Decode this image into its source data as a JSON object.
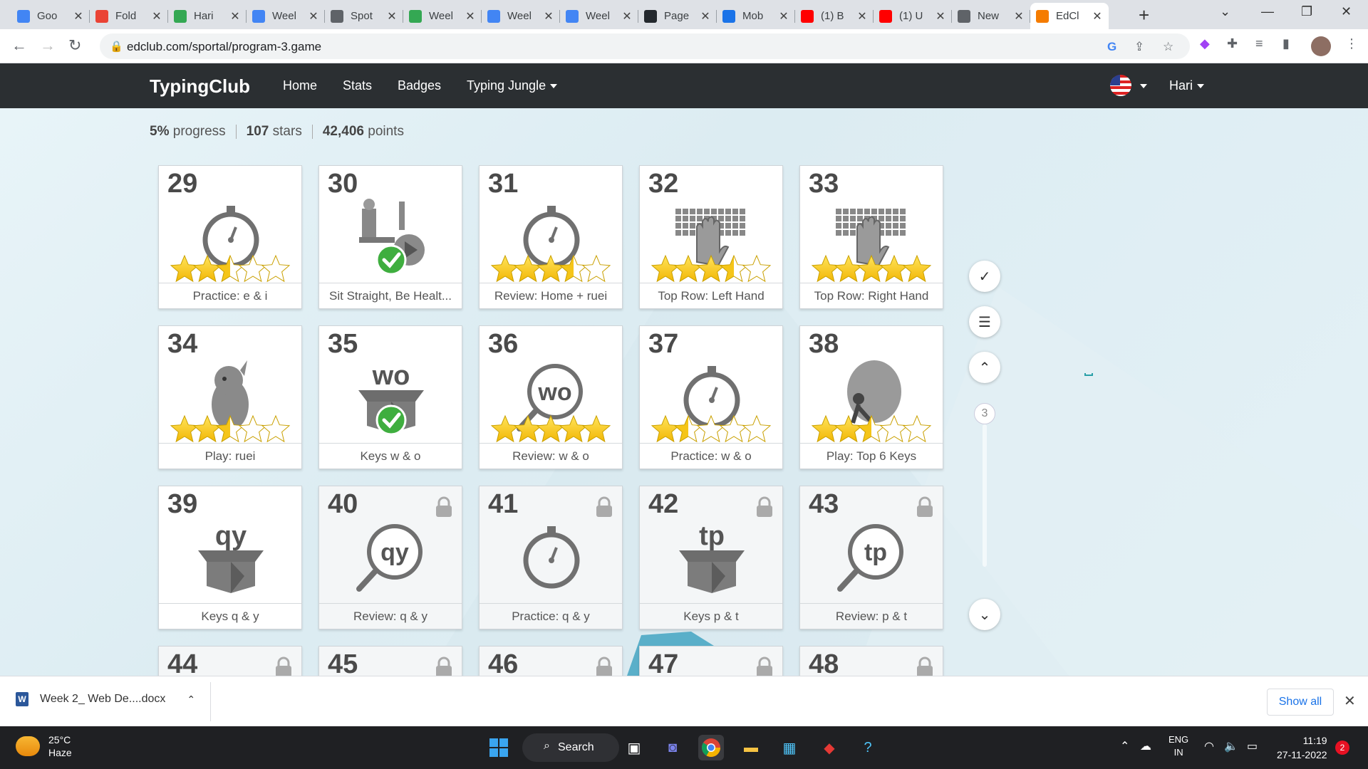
{
  "browser": {
    "tabs": [
      {
        "label": "Goo",
        "icon": "google-icon",
        "color": "#4285f4"
      },
      {
        "label": "Fold",
        "icon": "gmail-icon",
        "color": "#ea4335"
      },
      {
        "label": "Hari",
        "icon": "drive-icon",
        "color": "#34a853"
      },
      {
        "label": "Weel",
        "icon": "docs-icon",
        "color": "#4285f4"
      },
      {
        "label": "Spot",
        "icon": "globe-icon",
        "color": "#5f6368"
      },
      {
        "label": "Weel",
        "icon": "drive-icon",
        "color": "#34a853"
      },
      {
        "label": "Weel",
        "icon": "docs-icon",
        "color": "#4285f4"
      },
      {
        "label": "Weel",
        "icon": "docs-icon",
        "color": "#4285f4"
      },
      {
        "label": "Page",
        "icon": "github-icon",
        "color": "#24292e"
      },
      {
        "label": "Mob",
        "icon": "record-icon",
        "color": "#1a73e8"
      },
      {
        "label": "(1) B",
        "icon": "youtube-icon",
        "color": "#ff0000"
      },
      {
        "label": "(1) U",
        "icon": "youtube-icon",
        "color": "#ff0000"
      },
      {
        "label": "New",
        "icon": "chrome-icon",
        "color": "#5f6368"
      },
      {
        "label": "EdCl",
        "icon": "edclub-icon",
        "color": "#f57c00",
        "active": true
      }
    ],
    "url": "edclub.com/sportal/program-3.game"
  },
  "appnav": {
    "brand": "TypingClub",
    "links": [
      "Home",
      "Stats",
      "Badges",
      "Typing Jungle"
    ],
    "user": "Hari"
  },
  "progress": {
    "percent": "5%",
    "percent_label": "progress",
    "stars": "107",
    "stars_label": "stars",
    "points": "42,406",
    "points_label": "points"
  },
  "lessons": [
    {
      "num": "29",
      "label": "Practice: e & i",
      "art": "stopwatch",
      "stars": 2.5,
      "locked": false
    },
    {
      "num": "30",
      "label": "Sit Straight, Be Healt...",
      "art": "video",
      "stars": 0,
      "locked": false,
      "done": true
    },
    {
      "num": "31",
      "label": "Review: Home + ruei",
      "art": "stopwatch",
      "stars": 3.5,
      "locked": false
    },
    {
      "num": "32",
      "label": "Top Row: Left Hand",
      "art": "keyboard",
      "stars": 3.5,
      "locked": false
    },
    {
      "num": "33",
      "label": "Top Row: Right Hand",
      "art": "keyboard",
      "stars": 5,
      "locked": false
    },
    {
      "num": "34",
      "label": "Play: ruei",
      "art": "creature",
      "stars": 2.5,
      "locked": false
    },
    {
      "num": "35",
      "label": "Keys w & o",
      "art": "box",
      "artText": "wo",
      "stars": 0,
      "locked": false,
      "done": true
    },
    {
      "num": "36",
      "label": "Review: w & o",
      "art": "magnifier",
      "artText": "wo",
      "stars": 5,
      "locked": false
    },
    {
      "num": "37",
      "label": "Practice: w & o",
      "art": "stopwatch",
      "stars": 1.5,
      "locked": false
    },
    {
      "num": "38",
      "label": "Play: Top 6 Keys",
      "art": "boulder",
      "stars": 2.5,
      "locked": false
    },
    {
      "num": "39",
      "label": "Keys q & y",
      "art": "box",
      "artText": "qy",
      "stars": 0,
      "locked": false
    },
    {
      "num": "40",
      "label": "Review: q & y",
      "art": "magnifier",
      "artText": "qy",
      "stars": 0,
      "locked": true
    },
    {
      "num": "41",
      "label": "Practice: q & y",
      "art": "stopwatch",
      "stars": 0,
      "locked": true
    },
    {
      "num": "42",
      "label": "Keys p & t",
      "art": "box",
      "artText": "tp",
      "stars": 0,
      "locked": true
    },
    {
      "num": "43",
      "label": "Review: p & t",
      "art": "magnifier",
      "artText": "tp",
      "stars": 0,
      "locked": true
    },
    {
      "num": "44",
      "label": "",
      "art": "none",
      "stars": 0,
      "locked": true
    },
    {
      "num": "45",
      "label": "",
      "art": "none",
      "stars": 0,
      "locked": true
    },
    {
      "num": "46",
      "label": "",
      "art": "none",
      "stars": 0,
      "locked": true
    },
    {
      "num": "47",
      "label": "",
      "art": "none",
      "stars": 0,
      "locked": true
    },
    {
      "num": "48",
      "label": "",
      "art": "none",
      "stars": 0,
      "locked": true
    }
  ],
  "side": {
    "page": "3"
  },
  "download": {
    "filename": "Week 2_ Web De....docx",
    "show_all": "Show all"
  },
  "taskbar": {
    "temp": "25°C",
    "weather": "Haze",
    "search": "Search",
    "lang1": "ENG",
    "lang2": "IN",
    "time": "11:19",
    "date": "27-11-2022",
    "notifications": "2"
  },
  "colors": {
    "accent_gold": "#f5c518",
    "navbar": "#2b2f32",
    "check_green": "#3fae3f"
  }
}
